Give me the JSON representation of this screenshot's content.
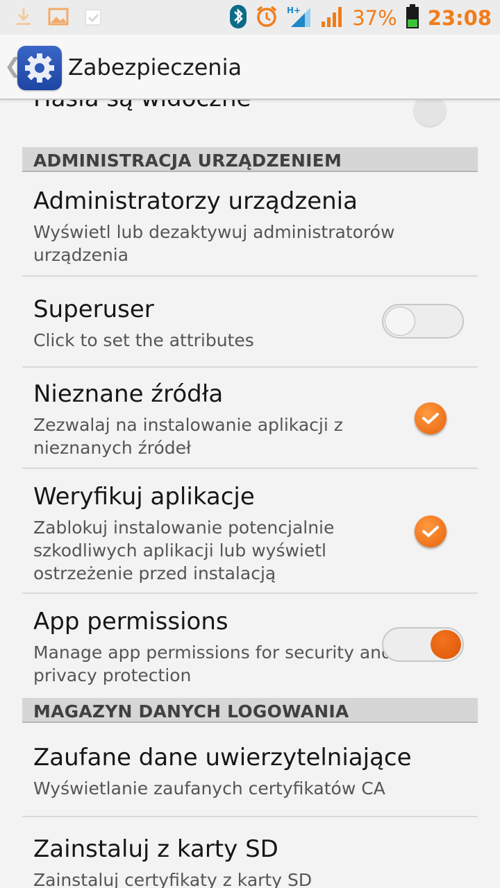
{
  "status_bar": {
    "battery_percent": "37%",
    "time": "23:08",
    "accent_color": "#f07d1a",
    "left_icons": [
      "download-icon",
      "image-icon",
      "clipboard-check-icon"
    ],
    "right_icons": [
      "bluetooth-icon",
      "alarm-icon",
      "signal-hplus-icon",
      "cell-signal-icon",
      "battery-icon"
    ]
  },
  "action_bar": {
    "title": "Zabezpieczenia",
    "icon": "settings-gear-icon"
  },
  "partial_item": {
    "title": "Hasła są widoczne"
  },
  "sections": [
    {
      "header": "ADMINISTRACJA URZĄDZENIEM"
    },
    {
      "header": "MAGAZYN DANYCH LOGOWANIA"
    }
  ],
  "items": [
    {
      "title": "Administratorzy urządzenia",
      "subtitle": "Wyświetl lub dezaktywuj administratorów urządzenia"
    },
    {
      "title": "Superuser",
      "subtitle": "Click to set the attributes",
      "toggle": "off"
    },
    {
      "title": "Nieznane źródła",
      "subtitle": "Zezwalaj na instalowanie aplikacji z nieznanych źródeł",
      "checked": true
    },
    {
      "title": "Weryfikuj aplikacje",
      "subtitle": "Zablokuj instalowanie potencjalnie szkodliwych aplikacji lub wyświetl ostrzeżenie przed instalacją",
      "checked": true
    },
    {
      "title": "App permissions",
      "subtitle": "Manage app permissions for security and privacy protection",
      "toggle": "on"
    },
    {
      "title": "Zaufane dane uwierzytelniające",
      "subtitle": "Wyświetlanie zaufanych certyfikatów CA"
    },
    {
      "title": "Zainstaluj z karty SD",
      "subtitle": "Zainstaluj certyfikaty z karty SD"
    }
  ]
}
